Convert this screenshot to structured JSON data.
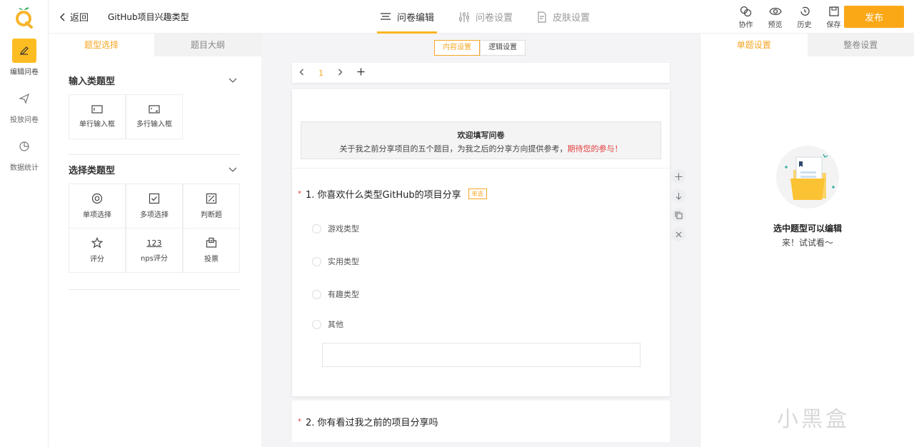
{
  "app": {
    "publish_label": "发布"
  },
  "rail": {
    "items": [
      {
        "label": "编辑问卷",
        "icon": "pencil-icon"
      },
      {
        "label": "投放问卷",
        "icon": "send-icon"
      },
      {
        "label": "数据统计",
        "icon": "pie-chart-icon"
      }
    ]
  },
  "header": {
    "back_label": "返回",
    "survey_title": "GitHub项目兴趣类型",
    "tabs": [
      {
        "label": "问卷编辑",
        "icon": "list-icon"
      },
      {
        "label": "问卷设置",
        "icon": "sliders-icon"
      },
      {
        "label": "皮肤设置",
        "icon": "document-icon"
      }
    ],
    "tools": [
      {
        "label": "协作",
        "icon": "link-icon"
      },
      {
        "label": "预览",
        "icon": "eye-icon"
      },
      {
        "label": "历史",
        "icon": "history-icon"
      },
      {
        "label": "保存",
        "icon": "save-icon"
      }
    ]
  },
  "left_panel": {
    "tabs": [
      "题型选择",
      "题目大纲"
    ],
    "groups": [
      {
        "title": "输入类题型",
        "items": [
          "单行输入框",
          "多行输入框"
        ]
      },
      {
        "title": "选择类题型",
        "items": [
          "单项选择",
          "多项选择",
          "判断题",
          "评分",
          "nps评分",
          "投票"
        ]
      }
    ],
    "nps_icon_text": "123"
  },
  "center": {
    "segments": [
      "内容设置",
      "逻辑设置"
    ],
    "page_number": "1",
    "welcome": {
      "title": "欢迎填写问卷",
      "desc": "关于我之前分享项目的五个题目，为我之后的分享方向提供参考，",
      "highlight": "期待您的参与！"
    },
    "question1": {
      "required": "*",
      "title": "1. 你喜欢什么类型GitHub的项目分享",
      "badge": "单选",
      "options": [
        "游戏类型",
        "实用类型",
        "有趣类型",
        "其他"
      ]
    },
    "question2": {
      "required": "*",
      "title": "2. 你有看过我之前的项目分享吗"
    }
  },
  "right_panel": {
    "tabs": [
      "单题设置",
      "整卷设置"
    ],
    "empty_title": "选中题型可以编辑",
    "empty_sub": "来！试试看～"
  },
  "watermark": "小黑盒",
  "colors": {
    "accent": "#fba817",
    "required": "#e23c3c"
  }
}
